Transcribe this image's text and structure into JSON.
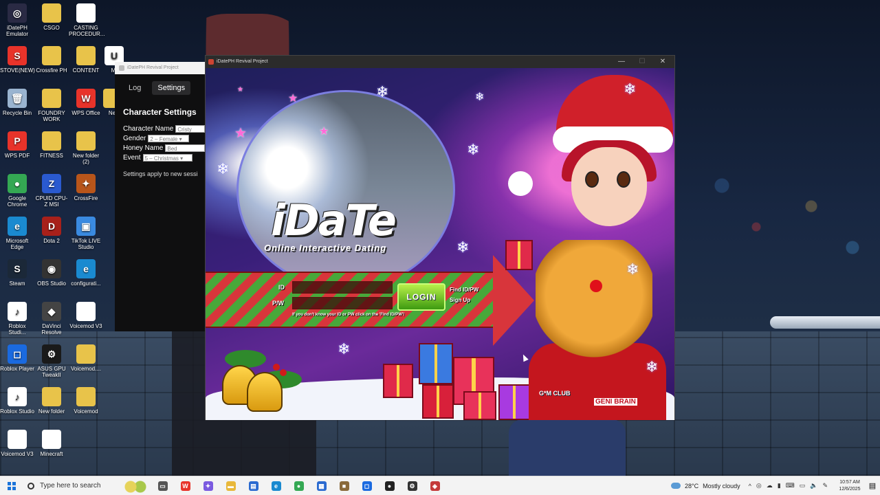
{
  "desktop": {
    "icons": [
      {
        "label": "iDatePH Emulator",
        "icon": "idate-emulator-icon",
        "color": "#2a2a44",
        "glyph": "◎"
      },
      {
        "label": "CSGO",
        "icon": "csgo-folder-icon",
        "color": "#e8c34a",
        "glyph": ""
      },
      {
        "label": "CASTING PROCEDUR...",
        "icon": "document-icon",
        "color": "#ffffff",
        "glyph": ""
      },
      {
        "label": "STOVE(NEW)",
        "icon": "stove-icon",
        "color": "#e8332a",
        "glyph": "S"
      },
      {
        "label": "Crossfire PH",
        "icon": "crossfire-folder-icon",
        "color": "#e8c34a",
        "glyph": ""
      },
      {
        "label": "CONTENT",
        "icon": "content-folder-icon",
        "color": "#e8c34a",
        "glyph": ""
      },
      {
        "label": "Recycle Bin",
        "icon": "recycle-bin-icon",
        "color": "#9ab4d0",
        "glyph": "🗑"
      },
      {
        "label": "FOUNDRY WORK",
        "icon": "foundry-folder-icon",
        "color": "#e8c34a",
        "glyph": ""
      },
      {
        "label": "WPS Office",
        "icon": "wps-office-icon",
        "color": "#e8332a",
        "glyph": "W"
      },
      {
        "label": "WPS PDF",
        "icon": "wps-pdf-icon",
        "color": "#e8332a",
        "glyph": "P"
      },
      {
        "label": "FITNESS",
        "icon": "fitness-folder-icon",
        "color": "#e8c34a",
        "glyph": ""
      },
      {
        "label": "New folder (2)",
        "icon": "new-folder-icon",
        "color": "#e8c34a",
        "glyph": ""
      },
      {
        "label": "Google Chrome",
        "icon": "chrome-icon",
        "color": "#34a853",
        "glyph": "●"
      },
      {
        "label": "CPUID CPU-Z MSI",
        "icon": "cpuz-icon",
        "color": "#2a5ad0",
        "glyph": "Z"
      },
      {
        "label": "CrossFire",
        "icon": "crossfire-icon",
        "color": "#b8551a",
        "glyph": "✦"
      },
      {
        "label": "Microsoft Edge",
        "icon": "edge-icon",
        "color": "#1a8ad0",
        "glyph": "e"
      },
      {
        "label": "Dota 2",
        "icon": "dota2-icon",
        "color": "#a8201a",
        "glyph": "D"
      },
      {
        "label": "TikTok LIVE Studio",
        "icon": "tiktok-live-icon",
        "color": "#3a8ae0",
        "glyph": "▣"
      },
      {
        "label": "Steam",
        "icon": "steam-icon",
        "color": "#1b2838",
        "glyph": "S"
      },
      {
        "label": "OBS Studio",
        "icon": "obs-icon",
        "color": "#333333",
        "glyph": "◉"
      },
      {
        "label": "configurati...",
        "icon": "configuration-icon",
        "color": "#1a8ad0",
        "glyph": "e"
      },
      {
        "label": "Roblox Studi...",
        "icon": "roblox-studio-icon",
        "color": "#ffffff",
        "glyph": "♪"
      },
      {
        "label": "DaVinci Resolve",
        "icon": "davinci-icon",
        "color": "#444444",
        "glyph": "◆"
      },
      {
        "label": "Voicemod V3",
        "icon": "voicemod-doc-icon",
        "color": "#ffffff",
        "glyph": ""
      },
      {
        "label": "Roblox Player",
        "icon": "roblox-player-icon",
        "color": "#1a6ae0",
        "glyph": "◻"
      },
      {
        "label": "ASUS GPU TweakII",
        "icon": "asus-gpu-icon",
        "color": "#1a1a1a",
        "glyph": "⚙"
      },
      {
        "label": "Voicemod....",
        "icon": "voicemod-folder-icon",
        "color": "#e8c34a",
        "glyph": ""
      },
      {
        "label": "Roblox Studio",
        "icon": "roblox-studio-2-icon",
        "color": "#ffffff",
        "glyph": "♪"
      },
      {
        "label": "New folder",
        "icon": "new-folder-2-icon",
        "color": "#e8c34a",
        "glyph": ""
      },
      {
        "label": "Voicemod",
        "icon": "voicemod-icon",
        "color": "#e8c34a",
        "glyph": ""
      },
      {
        "label": "Voicemod V3",
        "icon": "voicemod-v3-icon",
        "color": "#ffffff",
        "glyph": ""
      },
      {
        "label": "Minecraft",
        "icon": "minecraft-icon",
        "color": "#ffffff",
        "glyph": ""
      },
      {
        "label": "M",
        "icon": "partial-icon",
        "color": "#ffffff",
        "glyph": "U"
      },
      {
        "label": "Ne",
        "icon": "partial-icon-2",
        "color": "#e8c34a",
        "glyph": ""
      }
    ]
  },
  "settings_window": {
    "title": "iDatePH Revival Project",
    "tabs": [
      "Log",
      "Settings"
    ],
    "heading": "Character Settings",
    "character_name_label": "Character Name",
    "character_name_value": "Cristy",
    "gender_label": "Gender",
    "gender_value": "2 – Female",
    "honey_name_label": "Honey Name",
    "honey_name_value": "Bed",
    "event_label": "Event",
    "event_value": "5 – Christmas",
    "note": "Settings apply to new sessi"
  },
  "game_window": {
    "title": "iDatePH Revival Project",
    "logo": "iDaTe",
    "logo_sub": "Online Interactive Dating",
    "id_label": "ID",
    "pw_label": "P/W",
    "login_button": "LOGIN",
    "find_link": "Find ID/PW",
    "signup_link": "Sign Up",
    "hint": "If you don't know your ID or PW click on the 'Find ID/PW'!",
    "gm_logo": "G*M CLUB",
    "gb_logo": "GENI BRAIN"
  },
  "taskbar": {
    "search_placeholder": "Type here to search",
    "pinned": [
      {
        "icon": "task-view-icon",
        "color": "#555555",
        "glyph": "▭"
      },
      {
        "icon": "wps-taskbar-icon",
        "color": "#e8332a",
        "glyph": "W"
      },
      {
        "icon": "copilot-icon",
        "color": "#7a5ae0",
        "glyph": "✦"
      },
      {
        "icon": "file-explorer-icon",
        "color": "#e8b83a",
        "glyph": "▬"
      },
      {
        "icon": "store-icon",
        "color": "#2a6ad0",
        "glyph": "▤"
      },
      {
        "icon": "edge-taskbar-icon",
        "color": "#1a8ad0",
        "glyph": "e"
      },
      {
        "icon": "chrome-taskbar-icon",
        "color": "#34a853",
        "glyph": "●"
      },
      {
        "icon": "calculator-icon",
        "color": "#2a6ad0",
        "glyph": "▦"
      },
      {
        "icon": "minecraft-taskbar-icon",
        "color": "#8a6a3a",
        "glyph": "■"
      },
      {
        "icon": "roblox-taskbar-icon",
        "color": "#1a6ae0",
        "glyph": "◻"
      },
      {
        "icon": "app-taskbar-icon",
        "color": "#222222",
        "glyph": "●"
      },
      {
        "icon": "settings-taskbar-icon",
        "color": "#333333",
        "glyph": "⚙"
      },
      {
        "icon": "game-taskbar-icon",
        "color": "#c43a3a",
        "glyph": "◈"
      }
    ],
    "weather_temp": "28°C",
    "weather_text": "Mostly cloudy",
    "time": "10:57 AM",
    "date": "12/6/2025"
  }
}
